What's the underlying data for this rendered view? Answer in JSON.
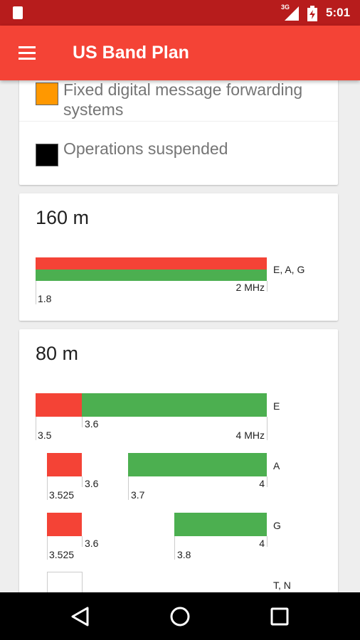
{
  "status_bar": {
    "network": "3G",
    "time": "5:01",
    "icons": [
      "sd-card-icon",
      "signal-icon",
      "battery-charging-icon"
    ]
  },
  "app_bar": {
    "title": "US Band Plan",
    "menu_icon": "menu-icon"
  },
  "legend": {
    "items": [
      {
        "label": "Fixed digital message forwarding systems",
        "color": "#ff9800"
      },
      {
        "label": "Operations suspended",
        "color": "#000000"
      }
    ]
  },
  "colors": {
    "red": "#f44336",
    "green": "#4caf50",
    "statusbar": "#b71c1c"
  },
  "bands": [
    {
      "title": "160 m",
      "rows": [
        {
          "license": "E, A, G",
          "labels": {
            "start": "1.8",
            "end": "2 MHz"
          }
        }
      ]
    },
    {
      "title": "80 m",
      "rows": [
        {
          "license": "E",
          "labels": {
            "start": "3.5",
            "mid": "3.6",
            "end": "4 MHz"
          }
        },
        {
          "license": "A",
          "labels": {
            "seg1_start": "3.525",
            "seg1_end": "3.6",
            "seg2_start": "3.7",
            "seg2_end": "4"
          }
        },
        {
          "license": "G",
          "labels": {
            "seg1_start": "3.525",
            "seg1_end": "3.6",
            "seg2_start": "3.8",
            "seg2_end": "4"
          }
        },
        {
          "license": "T, N"
        }
      ]
    }
  ],
  "nav_bar": {
    "buttons": [
      "back-icon",
      "home-icon",
      "recents-icon"
    ]
  }
}
